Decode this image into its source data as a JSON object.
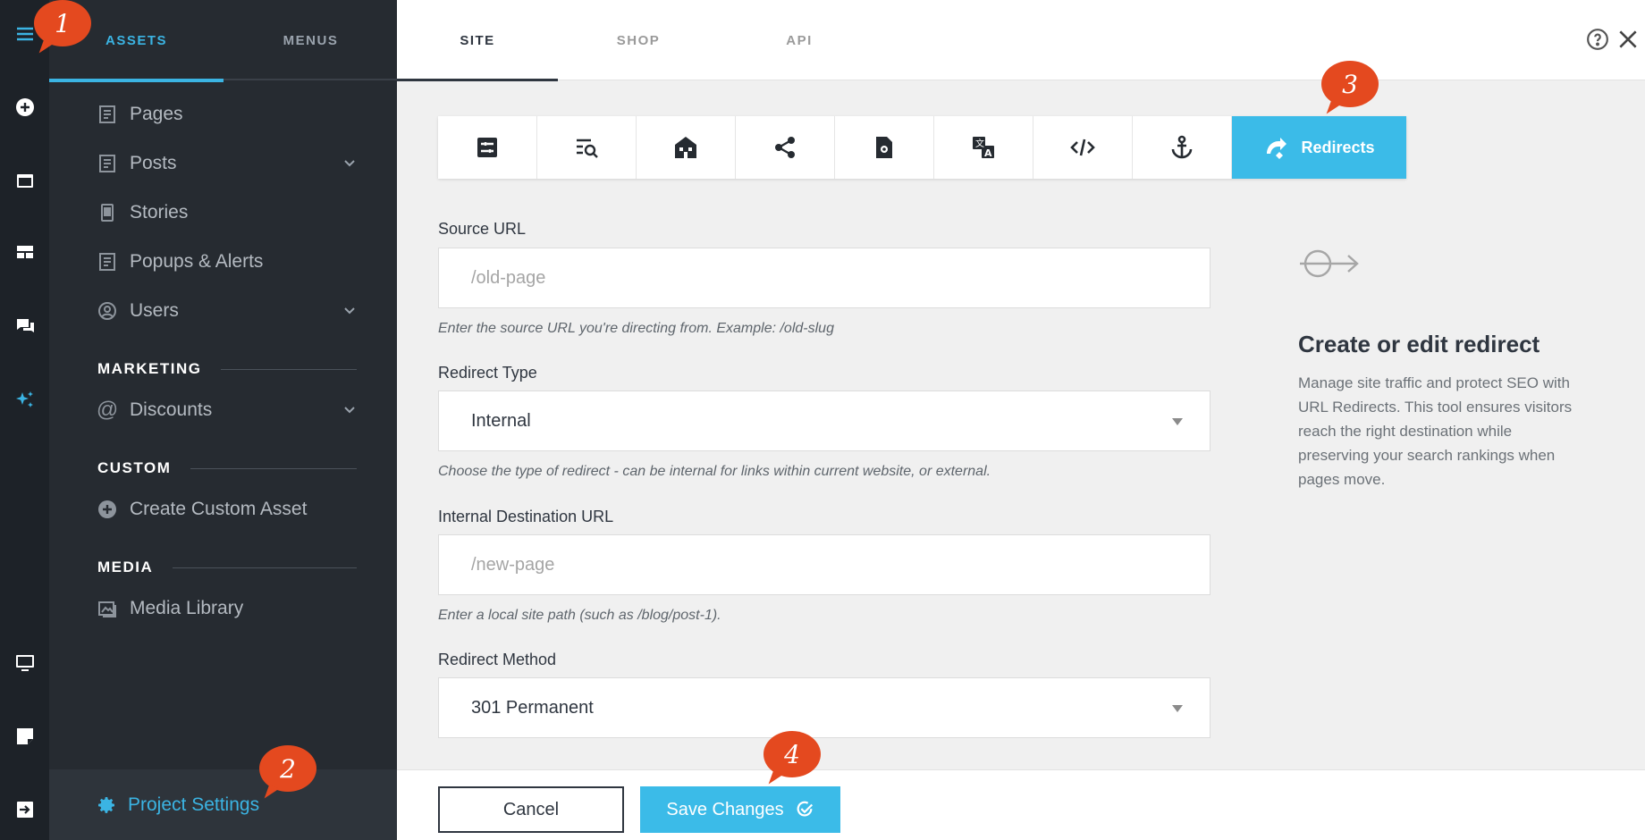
{
  "sidebar": {
    "tabs": [
      {
        "label": "ASSETS"
      },
      {
        "label": "MENUS"
      }
    ],
    "items": [
      {
        "label": "Pages"
      },
      {
        "label": "Posts"
      },
      {
        "label": "Stories"
      },
      {
        "label": "Popups & Alerts"
      },
      {
        "label": "Users"
      },
      {
        "label": "Discounts"
      },
      {
        "label": "Create Custom Asset"
      },
      {
        "label": "Media Library"
      }
    ],
    "sections": {
      "marketing": "MARKETING",
      "custom": "CUSTOM",
      "media": "MEDIA"
    },
    "project_settings": "Project Settings"
  },
  "topbar": {
    "tabs": [
      {
        "label": "SITE"
      },
      {
        "label": "SHOP"
      },
      {
        "label": "API"
      }
    ]
  },
  "toolbar": {
    "icons": [
      "settings-sliders-icon",
      "seo-search-icon",
      "house-icon",
      "share-icon",
      "file-settings-icon",
      "translate-icon",
      "code-icon",
      "anchor-icon",
      "redirect-icon"
    ],
    "active_label": "Redirects"
  },
  "form": {
    "source_label": "Source URL",
    "source_placeholder": "/old-page",
    "source_help": "Enter the source URL you're directing from. Example: /old-slug",
    "type_label": "Redirect Type",
    "type_value": "Internal",
    "type_help": "Choose the type of redirect - can be internal for links within current website, or external.",
    "dest_label": "Internal Destination URL",
    "dest_placeholder": "/new-page",
    "dest_help": "Enter a local site path (such as /blog/post-1).",
    "method_label": "Redirect Method",
    "method_value": "301 Permanent"
  },
  "info": {
    "title": "Create or edit redirect",
    "body": "Manage site traffic and protect SEO with URL Redirects. This tool ensures visitors reach the right destination while preserving your search rankings when pages move."
  },
  "footer": {
    "cancel_label": "Cancel",
    "save_label": "Save Changes"
  },
  "callouts": [
    "1",
    "2",
    "3",
    "4"
  ],
  "colors": {
    "accent": "#3bbbe8",
    "callout": "#e4491f",
    "sidebar_bg": "#262b31",
    "rail_bg": "#1d2228"
  }
}
